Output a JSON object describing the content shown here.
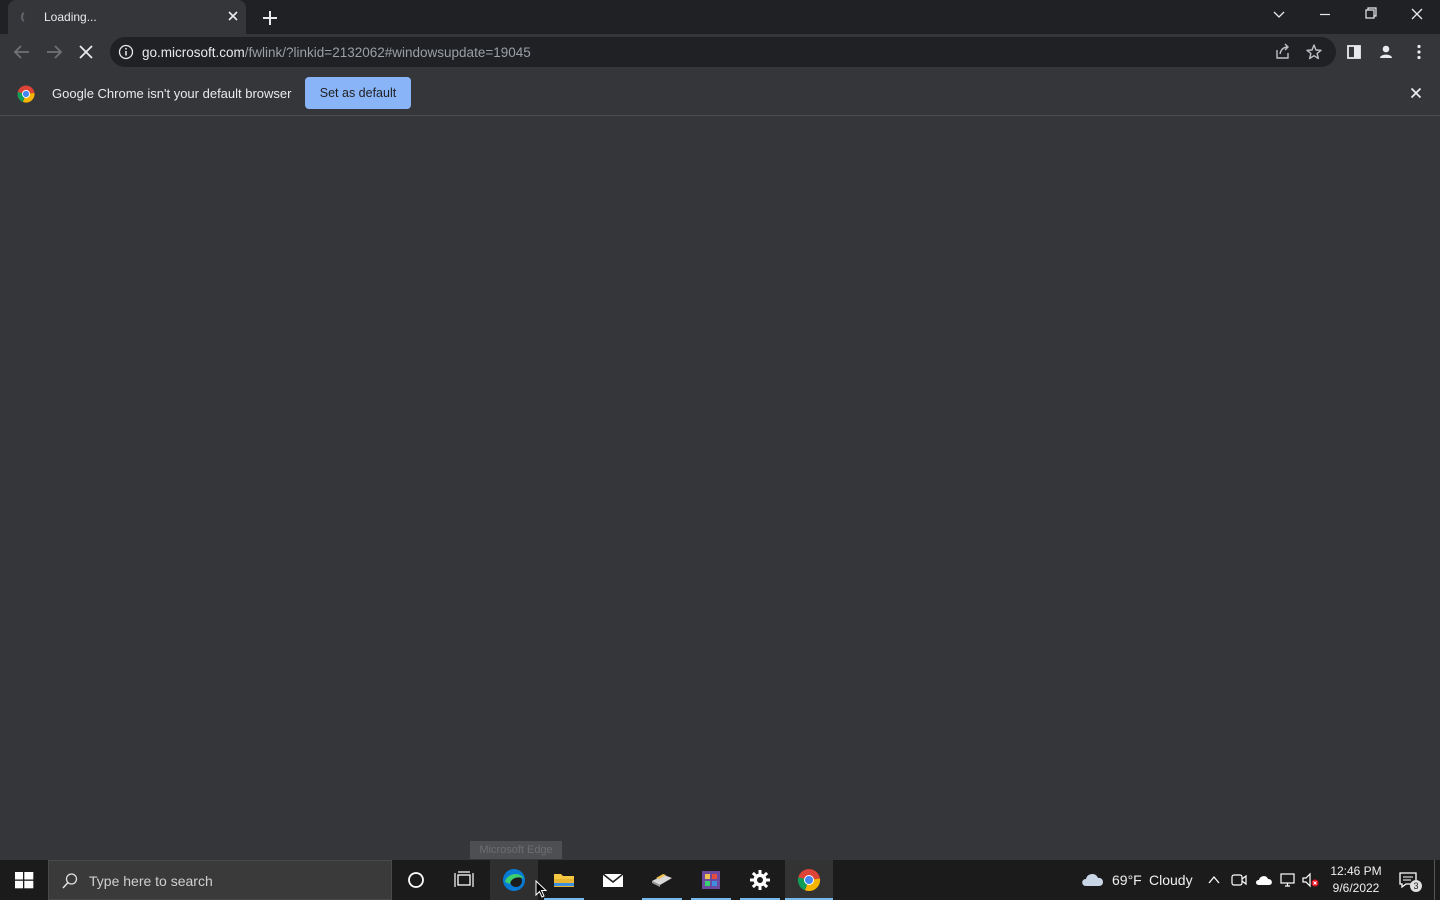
{
  "tab": {
    "title": "Loading..."
  },
  "omnibox": {
    "url_host": "go.microsoft.com",
    "url_rest": "/fwlink/?linkid=2132062#windowsupdate=19045"
  },
  "infobar": {
    "message": "Google Chrome isn't your default browser",
    "button": "Set as default"
  },
  "tooltip": "Microsoft Edge",
  "taskbar": {
    "search_placeholder": "Type here to search",
    "weather_temp": "69°F",
    "weather_desc": "Cloudy",
    "time": "12:46 PM",
    "date": "9/6/2022",
    "notification_count": "3"
  },
  "icons": [
    "spinner-icon",
    "close-icon",
    "plus-icon",
    "chevron-down-icon",
    "minimize-icon",
    "restore-icon",
    "back-arrow-icon",
    "forward-arrow-icon",
    "stop-icon",
    "info-icon",
    "share-icon",
    "star-icon",
    "side-panel-icon",
    "profile-icon",
    "menu-dots-icon",
    "chrome-logo",
    "windows-icon",
    "search-icon",
    "cortana-icon",
    "task-view-icon",
    "edge-icon",
    "file-explorer-icon",
    "mail-icon",
    "cloud-icon",
    "wifi-network-icon",
    "speaker-muted-icon",
    "action-center-icon"
  ]
}
